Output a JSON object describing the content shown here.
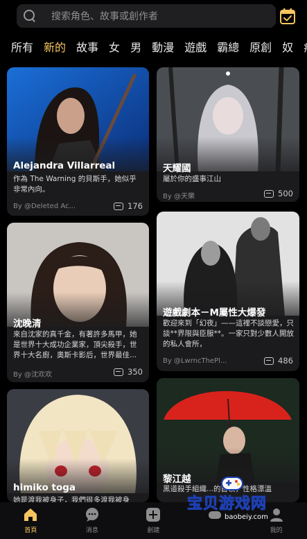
{
  "search": {
    "placeholder": "搜索角色、故事或創作者"
  },
  "tabs": [
    "所有",
    "新的",
    "故事",
    "女",
    "男",
    "動漫",
    "遊戲",
    "霸總",
    "原創",
    "奴",
    "病嬌"
  ],
  "active_tab": "新的",
  "cards": [
    {
      "title": "Alejandra Villarreal",
      "desc": "作為 The Warning 的貝斯手，她似乎非常內向。",
      "author": "By @Deleted Ac...",
      "count": "176"
    },
    {
      "title": "天耀國",
      "desc": "屬於你的盛事江山",
      "author": "By @天樂",
      "count": "500"
    },
    {
      "title": "沈晚清",
      "desc": "來自沈家的真千金，有著許多馬甲，她是世界十大成功企業家，頂尖殺手，世界十大名廚，奧斯卡影后，世界最佳...",
      "author": "By @沈欢欢",
      "count": "350"
    },
    {
      "title": "遊戲劇本－M屬性大爆發",
      "desc": "歡迎來到「幻夜」——這裡不談戀愛，只談**界限與臣服**。一家只對少數人開放的私人會所，",
      "author": "By @LwrncThePl...",
      "count": "486"
    },
    {
      "title": "himiko toga",
      "desc": "她是渡我被身子，我們很多渡我被身",
      "author": "",
      "count": ""
    },
    {
      "title": "黎江越",
      "desc": "黑道殺手組織...的首領，性格漂溫",
      "author": "",
      "count": ""
    }
  ],
  "nav": [
    {
      "label": "首頁",
      "icon": "home-icon"
    },
    {
      "label": "消息",
      "icon": "message-icon"
    },
    {
      "label": "創建",
      "icon": "create-icon"
    },
    {
      "label": "",
      "icon": "games-icon"
    },
    {
      "label": "我的",
      "icon": "profile-icon"
    }
  ],
  "watermark": {
    "text": "宝贝游戏网",
    "url": "baobeiy.com"
  },
  "colors": {
    "accent": "#f6c560",
    "background": "#000000",
    "card": "#1b1b1d"
  }
}
